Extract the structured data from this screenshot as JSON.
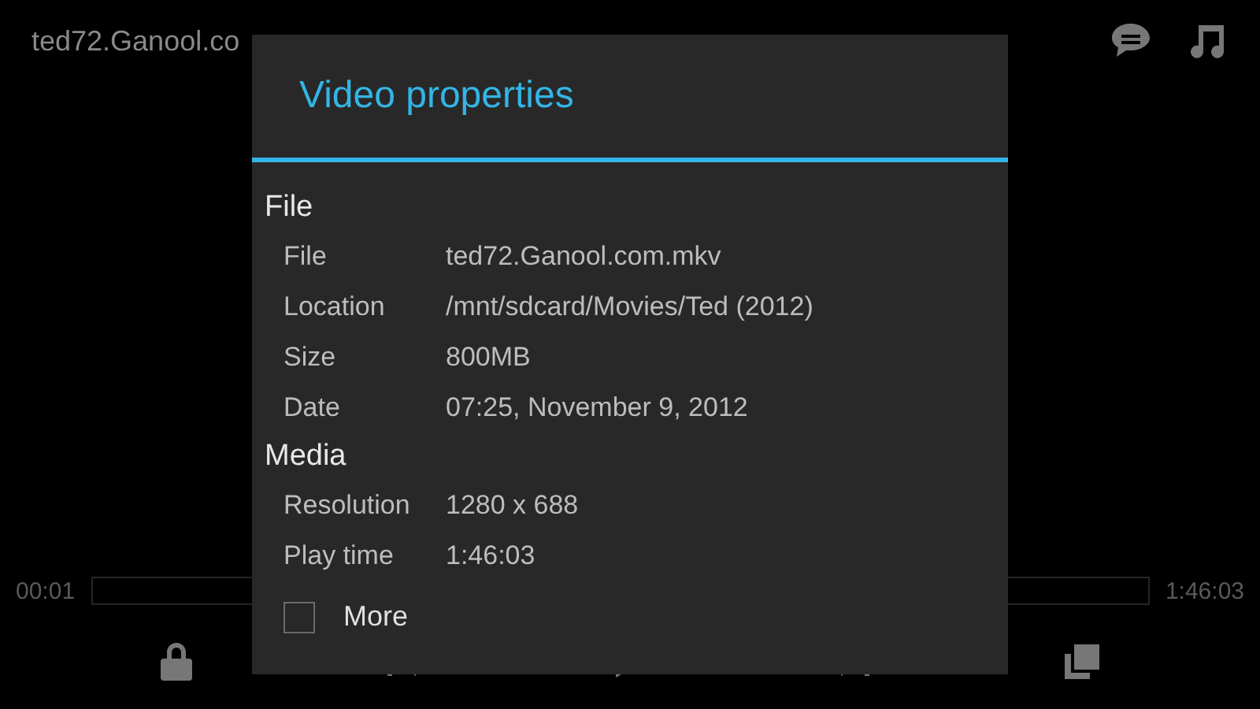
{
  "player": {
    "title": "ted72.Ganool.co",
    "elapsed": "00:01",
    "duration": "1:46:03"
  },
  "dialog": {
    "title": "Video properties",
    "sections": [
      {
        "heading": "File",
        "rows": [
          {
            "label": "File",
            "value": "ted72.Ganool.com.mkv"
          },
          {
            "label": "Location",
            "value": "/mnt/sdcard/Movies/Ted (2012)"
          },
          {
            "label": "Size",
            "value": "800MB"
          },
          {
            "label": "Date",
            "value": "07:25, November 9, 2012"
          }
        ]
      },
      {
        "heading": "Media",
        "rows": [
          {
            "label": "Resolution",
            "value": "1280 x 688"
          },
          {
            "label": "Play time",
            "value": "1:46:03"
          }
        ]
      }
    ],
    "more": {
      "label": "More",
      "checked": false
    }
  }
}
